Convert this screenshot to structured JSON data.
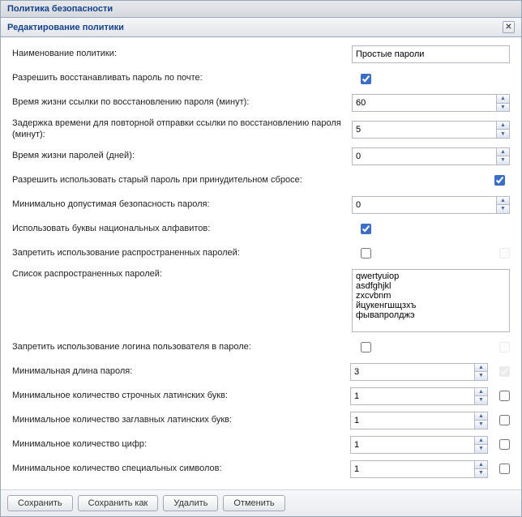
{
  "panel_title": "Политика безопасности",
  "subpanel_title": "Редактирование политики",
  "labels": {
    "name": "Наименование политики:",
    "allow_recovery": "Разрешить восстанавливать пароль по почте:",
    "link_ttl": "Время жизни ссылки по восстановлению пароля (минут):",
    "resend_delay": "Задержка времени для повторной отправки ссылки по восстановлению пароля (минут):",
    "pwd_ttl": "Время жизни паролей (дней):",
    "allow_old": "Разрешить использовать старый пароль при принудительном сбросе:",
    "min_strength": "Минимально допустимая безопасность пароля:",
    "use_national": "Использовать буквы национальных алфавитов:",
    "forbid_common": "Запретить использование распространенных паролей:",
    "common_list": "Список распространенных паролей:",
    "forbid_login": "Запретить использование логина пользователя в пароле:",
    "min_len": "Минимальная длина пароля:",
    "min_lower": "Минимальное количество строчных латинских букв:",
    "min_upper": "Минимальное количество заглавных латинских букв:",
    "min_digits": "Минимальное количество цифр:",
    "min_special": "Минимальное количество специальных символов:"
  },
  "values": {
    "name": "Простые пароли",
    "allow_recovery": true,
    "link_ttl": "60",
    "resend_delay": "5",
    "pwd_ttl": "0",
    "allow_old": true,
    "min_strength": "0",
    "use_national": true,
    "forbid_common": false,
    "common_list": "qwertyuiop\nasdfghjkl\nzxcvbnm\nйцукенгшщзхъ\nфывапролджэ",
    "forbid_login": false,
    "min_len": "3",
    "min_lower": "1",
    "min_upper": "1",
    "min_digits": "1",
    "min_special": "1"
  },
  "buttons": {
    "save": "Сохранить",
    "save_as": "Сохранить как",
    "delete": "Удалить",
    "cancel": "Отменить"
  }
}
